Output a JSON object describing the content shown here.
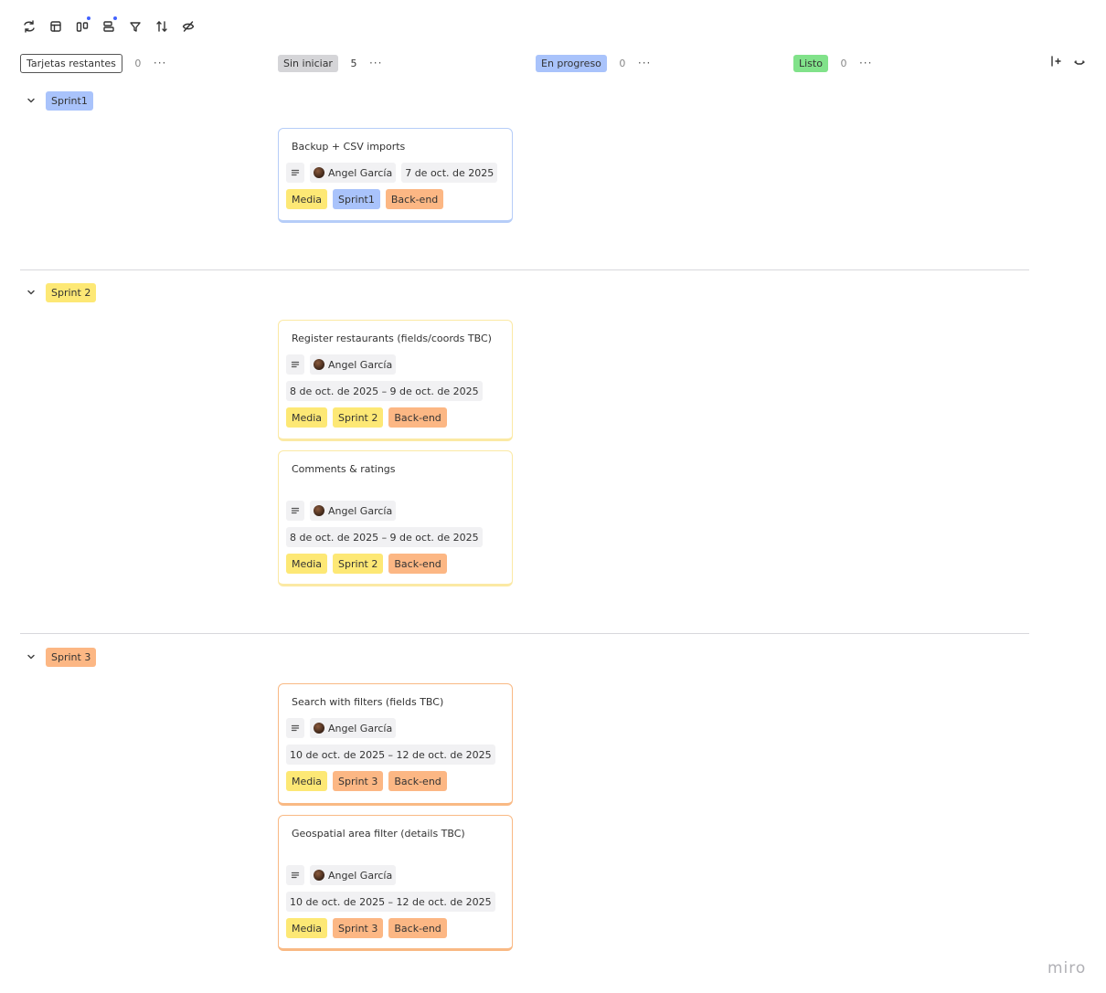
{
  "colors": {
    "blue": "#a9c3fb",
    "yellow": "#fde875",
    "orange": "#fcb784",
    "gray": "#d5d5d8",
    "green": "#81e28a",
    "card_blue_border": "#b6cdf8",
    "card_yellow_border": "#fbe9a4",
    "card_orange_border": "#f9b984"
  },
  "toolbar": {
    "icons": [
      "sync-icon",
      "layout-icon",
      "columns-icon",
      "rows-icon",
      "filter-icon",
      "sort-icon",
      "hide-icon"
    ]
  },
  "columns": [
    {
      "label": "Tarjetas restantes",
      "count": "0"
    },
    {
      "label": "Sin iniciar",
      "count": "5"
    },
    {
      "label": "En progreso",
      "count": "0"
    },
    {
      "label": "Listo",
      "count": "0"
    }
  ],
  "lanes": [
    {
      "label": "Sprint1",
      "cards": [
        {
          "title": "Backup + CSV imports",
          "assignee": "Angel García",
          "date": "7 de oct. de 2025",
          "tags": [
            "Media",
            "Sprint1",
            "Back-end"
          ]
        }
      ]
    },
    {
      "label": "Sprint 2",
      "cards": [
        {
          "title": "Register restaurants (fields/coords TBC)",
          "assignee": "Angel García",
          "date": "8 de oct. de 2025 – 9 de oct. de 2025",
          "tags": [
            "Media",
            "Sprint 2",
            "Back-end"
          ]
        },
        {
          "title": "Comments & ratings",
          "assignee": "Angel García",
          "date": "8 de oct. de 2025 – 9 de oct. de 2025",
          "tags": [
            "Media",
            "Sprint 2",
            "Back-end"
          ]
        }
      ]
    },
    {
      "label": "Sprint 3",
      "cards": [
        {
          "title": "Search with filters (fields TBC)",
          "assignee": "Angel García",
          "date": "10 de oct. de 2025 – 12 de oct. de 2025",
          "tags": [
            "Media",
            "Sprint 3",
            "Back-end"
          ]
        },
        {
          "title": "Geospatial area filter (details TBC)",
          "assignee": "Angel García",
          "date": "10 de oct. de 2025 – 12 de oct. de 2025",
          "tags": [
            "Media",
            "Sprint 3",
            "Back-end"
          ]
        }
      ]
    }
  ],
  "brand": "miro"
}
